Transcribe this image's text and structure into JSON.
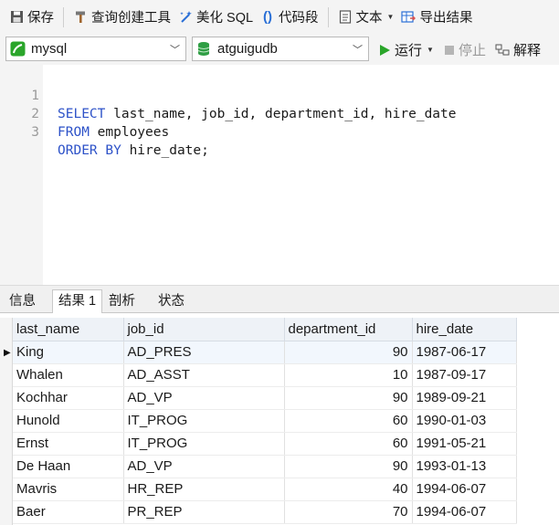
{
  "toolbar": {
    "save": "保存",
    "query_builder": "查询创建工具",
    "beautify": "美化 SQL",
    "snippet": "代码段",
    "text": "文本",
    "export": "导出结果"
  },
  "connection": {
    "server": "mysql",
    "database": "atguigudb",
    "run": "运行",
    "stop": "停止",
    "explain": "解释"
  },
  "editor": {
    "line_numbers": [
      "1",
      "2",
      "3"
    ],
    "lines": [
      {
        "kw": "SELECT",
        "rest": " last_name, job_id, department_id, hire_date"
      },
      {
        "kw": "FROM",
        "rest": " employees"
      },
      {
        "kw": "ORDER BY",
        "rest": " hire_date;"
      }
    ]
  },
  "tabs": [
    "信息",
    "结果 1",
    "剖析",
    "状态"
  ],
  "results": {
    "columns": [
      "last_name",
      "job_id",
      "department_id",
      "hire_date"
    ],
    "rows": [
      [
        "King",
        "AD_PRES",
        "90",
        "1987-06-17"
      ],
      [
        "Whalen",
        "AD_ASST",
        "10",
        "1987-09-17"
      ],
      [
        "Kochhar",
        "AD_VP",
        "90",
        "1989-09-21"
      ],
      [
        "Hunold",
        "IT_PROG",
        "60",
        "1990-01-03"
      ],
      [
        "Ernst",
        "IT_PROG",
        "60",
        "1991-05-21"
      ],
      [
        "De Haan",
        "AD_VP",
        "90",
        "1993-01-13"
      ],
      [
        "Mavris",
        "HR_REP",
        "40",
        "1994-06-07"
      ],
      [
        "Baer",
        "PR_REP",
        "70",
        "1994-06-07"
      ]
    ]
  },
  "colors": {
    "keyword": "#2d52c8",
    "run_icon": "#2aa52a",
    "db_icon": "#2f9e44"
  }
}
